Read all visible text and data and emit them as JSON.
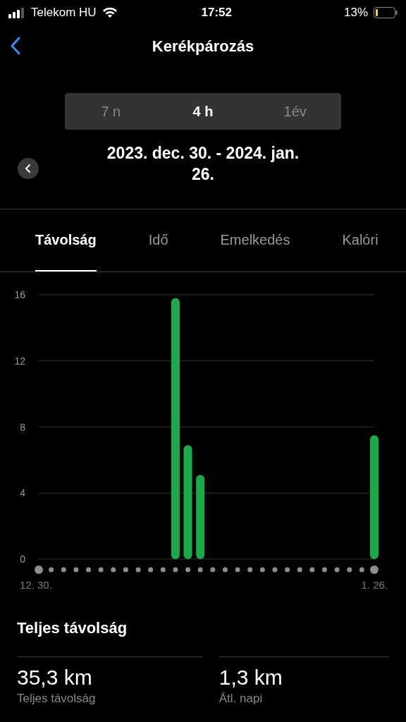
{
  "status_bar": {
    "carrier": "Telekom HU",
    "time": "17:52",
    "battery": "13%"
  },
  "nav": {
    "title": "Kerékpározás"
  },
  "segments": [
    {
      "label": "7 n",
      "selected": false
    },
    {
      "label": "4 h",
      "selected": true
    },
    {
      "label": "1év",
      "selected": false
    }
  ],
  "date_range": "2023. dec. 30. - 2024. jan. 26.",
  "tabs": [
    {
      "label": "Távolság",
      "selected": true
    },
    {
      "label": "Idő",
      "selected": false
    },
    {
      "label": "Emelkedés",
      "selected": false
    },
    {
      "label": "Kalóri",
      "selected": false
    }
  ],
  "chart": {
    "start_label": "12. 30.",
    "end_label": "1. 26.",
    "chart_data": {
      "type": "bar",
      "grid": true,
      "ylim": [
        0,
        16
      ],
      "yticks": [
        0,
        4,
        8,
        12,
        16
      ],
      "series": [
        {
          "color": "#1aaa4a",
          "values": [
            0,
            0,
            0,
            0,
            0,
            0,
            0,
            0,
            0,
            0,
            0,
            15.8,
            6.9,
            5.1,
            0,
            0,
            0,
            0,
            0,
            0,
            0,
            0,
            0,
            0,
            0,
            0,
            0,
            7.5
          ]
        }
      ]
    }
  },
  "summary": {
    "title": "Teljes távolság",
    "stats": [
      {
        "value": "35,3 km",
        "label": "Teljes távolság"
      },
      {
        "value": "1,3 km",
        "label": "Átl. napi"
      }
    ]
  }
}
